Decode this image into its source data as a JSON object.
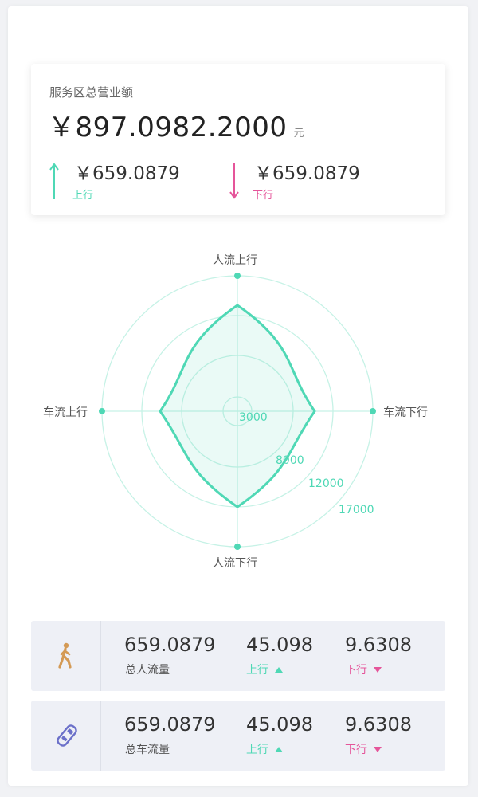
{
  "colors": {
    "accent_green": "#4fd8b5",
    "accent_pink": "#e5559a",
    "card_bg": "#eef0f6",
    "person_icon": "#d49a55",
    "vehicle_icon": "#6b70c9"
  },
  "revenue": {
    "title": "服务区总营业额",
    "total": "￥897.0982.2000",
    "unit": "元",
    "up": {
      "amount": "￥659.0879",
      "label": "上行",
      "icon": "arrow-up-icon"
    },
    "down": {
      "amount": "￥659.0879",
      "label": "下行",
      "icon": "arrow-down-icon"
    }
  },
  "radar": {
    "axes": [
      "人流上行",
      "车流下行",
      "人流下行",
      "车流上行"
    ],
    "ring_labels": [
      "3000",
      "8000",
      "12000",
      "17000"
    ]
  },
  "chart_data": {
    "type": "radar",
    "axes": [
      "人流上行",
      "车流下行",
      "人流下行",
      "车流上行"
    ],
    "ring_values": [
      3000,
      8000,
      12000,
      17000
    ],
    "range": [
      0,
      17000
    ],
    "values": [
      13300,
      9700,
      12000,
      9700
    ],
    "grid": true
  },
  "stats": {
    "people": {
      "icon": "walking-person-icon",
      "total": "659.0879",
      "total_label": "总人流量",
      "up_value": "45.098",
      "up_label": "上行",
      "down_value": "9.6308",
      "down_label": "下行"
    },
    "vehicle": {
      "icon": "car-icon",
      "total": "659.0879",
      "total_label": "总车流量",
      "up_value": "45.098",
      "up_label": "上行",
      "down_value": "9.6308",
      "down_label": "下行"
    }
  }
}
